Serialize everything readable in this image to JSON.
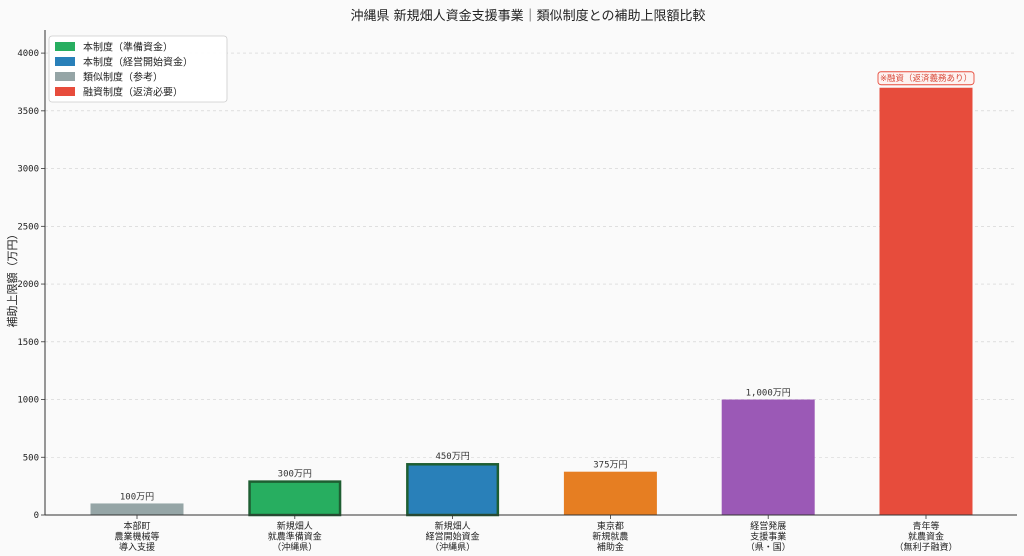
{
  "chart_data": {
    "type": "bar",
    "title": "沖縄県 新規畑人資金支援事業｜類似制度との補助上限額比較",
    "xlabel": "",
    "ylabel": "補助上限額（万円）",
    "ylim": [
      0,
      4200
    ],
    "yticks": [
      0,
      500,
      1000,
      1500,
      2000,
      2500,
      3000,
      3500,
      4000
    ],
    "grid": true,
    "legend_position": "top-left",
    "categories": [
      [
        "本部町",
        "農業機械等",
        "導入支援"
      ],
      [
        "新規畑人",
        "就農準備資金",
        "（沖縄県）"
      ],
      [
        "新規畑人",
        "経営開始資金",
        "（沖縄県）"
      ],
      [
        "東京都",
        "新規就農",
        "補助金"
      ],
      [
        "経営発展",
        "支援事業",
        "（県・国）"
      ],
      [
        "青年等",
        "就農資金",
        "（無利子融資）"
      ]
    ],
    "values": [
      100,
      300,
      450,
      375,
      1000,
      3700
    ],
    "value_labels": [
      "100万円",
      "300万円",
      "450万円",
      "375万円",
      "1,000万円",
      ""
    ],
    "colors": [
      "#95a5a6",
      "#27ae60",
      "#2980b9",
      "#e67e22",
      "#9b59b6",
      "#e74c3c"
    ],
    "highlighted": [
      false,
      true,
      true,
      false,
      false,
      false
    ],
    "highlight_edge_color": "#1e5e32",
    "annotation": {
      "text": "※融資（返済義務あり）",
      "bar_index": 5
    },
    "legend": [
      {
        "label": "本制度（準備資金）",
        "color": "#27ae60"
      },
      {
        "label": "本制度（経営開始資金）",
        "color": "#2980b9"
      },
      {
        "label": "類似制度（参考）",
        "color": "#95a5a6"
      },
      {
        "label": "融資制度（返済必要）",
        "color": "#e74c3c"
      }
    ]
  }
}
